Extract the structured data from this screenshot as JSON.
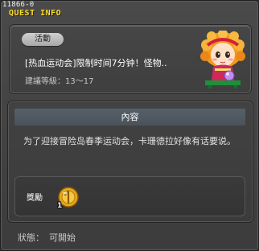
{
  "window": {
    "id": "11866-0",
    "title": "QUEST INFO"
  },
  "quest": {
    "category": "活動",
    "name": "[热血运动会]限制时间7分钟！怪物..",
    "level_text": "建議等級：13～17",
    "npc_icon": "npc-portrait-icon"
  },
  "content": {
    "header": "內容",
    "description": "为了迎接冒险岛春季运动会，卡珊德拉好像有话要说。"
  },
  "reward": {
    "label": "獎勵",
    "item_icon": "gold-medal-icon",
    "quantity": "1"
  },
  "status": {
    "label": "狀態：",
    "value": "可開始"
  },
  "colors": {
    "title": "#ffdd2b",
    "panel_bg": "#424242",
    "header_bg": "#566069"
  }
}
